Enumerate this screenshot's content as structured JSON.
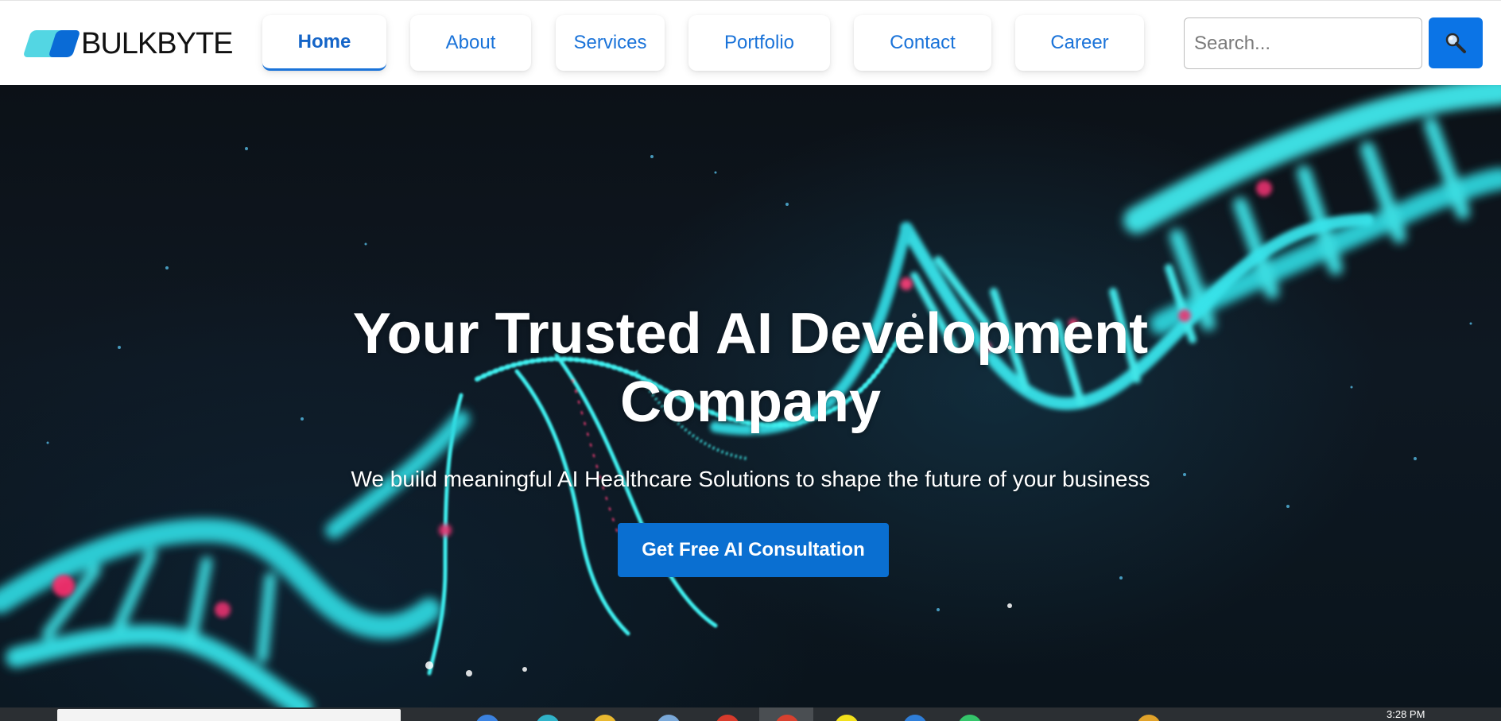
{
  "header": {
    "logo_text": "BULKBYTE",
    "nav": [
      {
        "label": "Home",
        "active": true
      },
      {
        "label": "About",
        "active": false
      },
      {
        "label": "Services",
        "active": false
      },
      {
        "label": "Portfolio",
        "active": false
      },
      {
        "label": "Contact",
        "active": false
      },
      {
        "label": "Career",
        "active": false
      }
    ],
    "search": {
      "placeholder": "Search...",
      "button_icon": "magnifier-icon"
    }
  },
  "hero": {
    "title": "Your Trusted AI Development Company",
    "subtitle": "We build meaningful AI Healthcare Solutions to shape the future of your business",
    "cta_label": "Get Free AI Consultation",
    "background": "dna-helix-illustration"
  },
  "taskbar": {
    "clock": "3:28 PM"
  },
  "colors": {
    "accent": "#1a73d9",
    "cta": "#0a6fd1",
    "search_button": "#0b74e6",
    "logo_cyan": "#53d6e3",
    "logo_blue": "#0a6bd6",
    "helix_cyan": "#3ff0f0",
    "helix_pink": "#e8336f"
  }
}
